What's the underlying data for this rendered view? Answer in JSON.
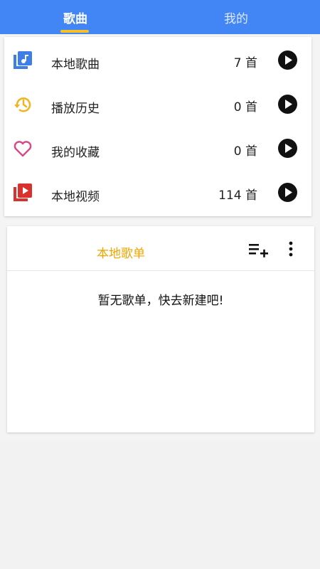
{
  "tabs": {
    "songs": "歌曲",
    "mine": "我的"
  },
  "library": {
    "items": [
      {
        "label": "本地歌曲",
        "count": "7 首",
        "icon": "music-library-icon",
        "color": "#3f7ee8"
      },
      {
        "label": "播放历史",
        "count": "0 首",
        "icon": "history-icon",
        "color": "#f2b31b"
      },
      {
        "label": "我的收藏",
        "count": "0 首",
        "icon": "heart-icon",
        "color": "#d34b86"
      },
      {
        "label": "本地视频",
        "count": "114 首",
        "icon": "video-library-icon",
        "color": "#d9322e"
      }
    ]
  },
  "playlist": {
    "title": "本地歌单",
    "empty_message": "暂无歌单，快去新建吧!"
  },
  "colors": {
    "tabbar": "#4285f4",
    "accent": "#f6c026",
    "playlist_title": "#f0a400"
  }
}
